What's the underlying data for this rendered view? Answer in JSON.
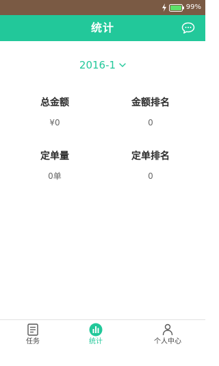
{
  "status_bar": {
    "battery": "99%"
  },
  "header": {
    "title": "统计",
    "chat_icon": "chat-bubble-icon"
  },
  "month_selector": {
    "value": "2016-1"
  },
  "stats": {
    "total_amount": {
      "label": "总金额",
      "value": "¥0"
    },
    "amount_rank": {
      "label": "金额排名",
      "value": "0"
    },
    "order_count": {
      "label": "定单量",
      "value": "0单"
    },
    "order_rank": {
      "label": "定单排名",
      "value": "0"
    }
  },
  "tabs": [
    {
      "label": "任务",
      "icon": "task-list-icon",
      "active": false
    },
    {
      "label": "统计",
      "icon": "stats-chart-icon",
      "active": true
    },
    {
      "label": "个人中心",
      "icon": "person-icon",
      "active": false
    }
  ],
  "colors": {
    "accent": "#22c89a",
    "status_bar": "#7a5a44"
  }
}
